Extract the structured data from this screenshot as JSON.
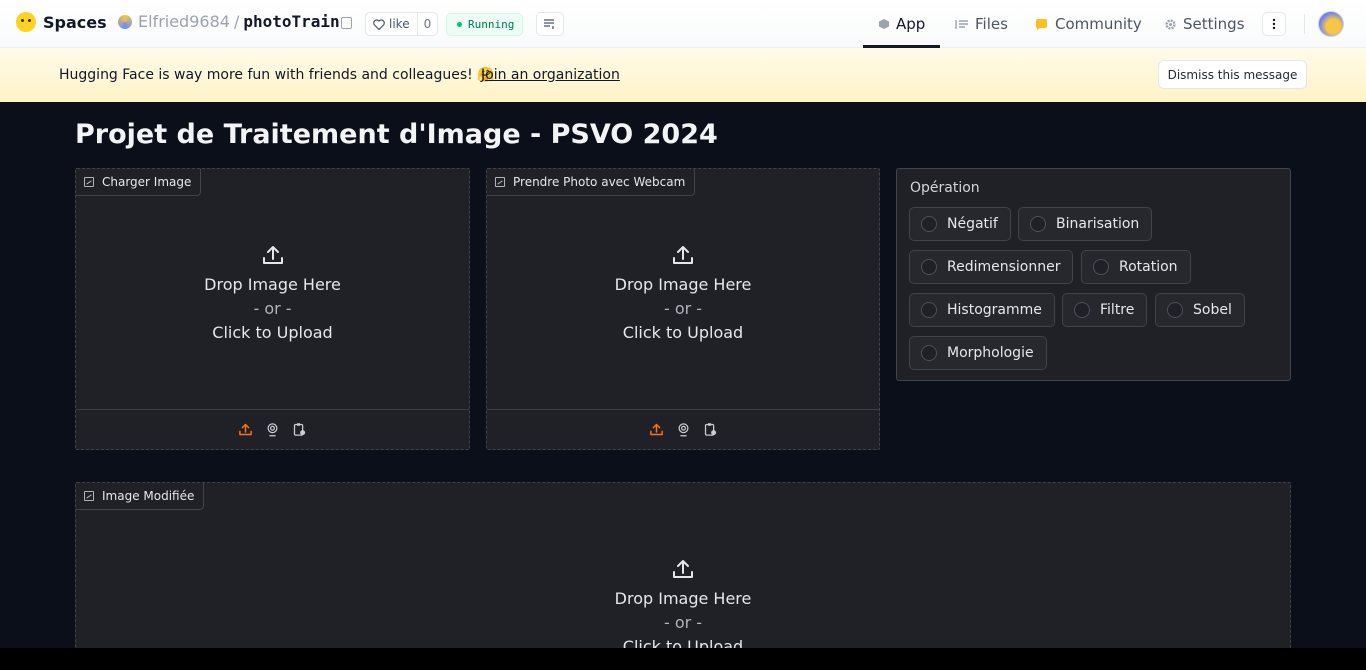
{
  "nav": {
    "brand": "Spaces",
    "owner": "Elfried9684",
    "separator": "/",
    "space_name": "photoTrain",
    "like_label": "like",
    "like_count": "0",
    "status": "Running",
    "tabs": [
      {
        "label": "App",
        "icon": "cube-icon"
      },
      {
        "label": "Files",
        "icon": "files-icon"
      },
      {
        "label": "Community",
        "icon": "community-icon"
      },
      {
        "label": "Settings",
        "icon": "gear-icon"
      }
    ],
    "active_tab": "App"
  },
  "banner": {
    "message": "Hugging Face is way more fun with friends and colleagues! 🤗",
    "join_link": "Join an organization",
    "dismiss_label": "Dismiss this message"
  },
  "app": {
    "title": "Projet de Traitement d'Image - PSVO 2024",
    "upload_panels": [
      {
        "label": "Charger Image",
        "drop_text": "Drop Image Here",
        "or_text": "- or -",
        "click_text": "Click to Upload"
      },
      {
        "label": "Prendre Photo avec Webcam",
        "drop_text": "Drop Image Here",
        "or_text": "- or -",
        "click_text": "Click to Upload"
      }
    ],
    "operation": {
      "label": "Opération",
      "options": [
        "Négatif",
        "Binarisation",
        "Redimensionner",
        "Rotation",
        "Histogramme",
        "Filtre",
        "Sobel",
        "Morphologie"
      ],
      "selected": null
    },
    "output_panel": {
      "label": "Image Modifiée",
      "drop_text": "Drop Image Here",
      "or_text": "- or -",
      "click_text": "Click to Upload"
    }
  },
  "colors": {
    "app_background": "#0b0f19",
    "panel_background": "#1f2126",
    "accent_orange": "#f97316",
    "banner_background": "#fef3c7"
  }
}
